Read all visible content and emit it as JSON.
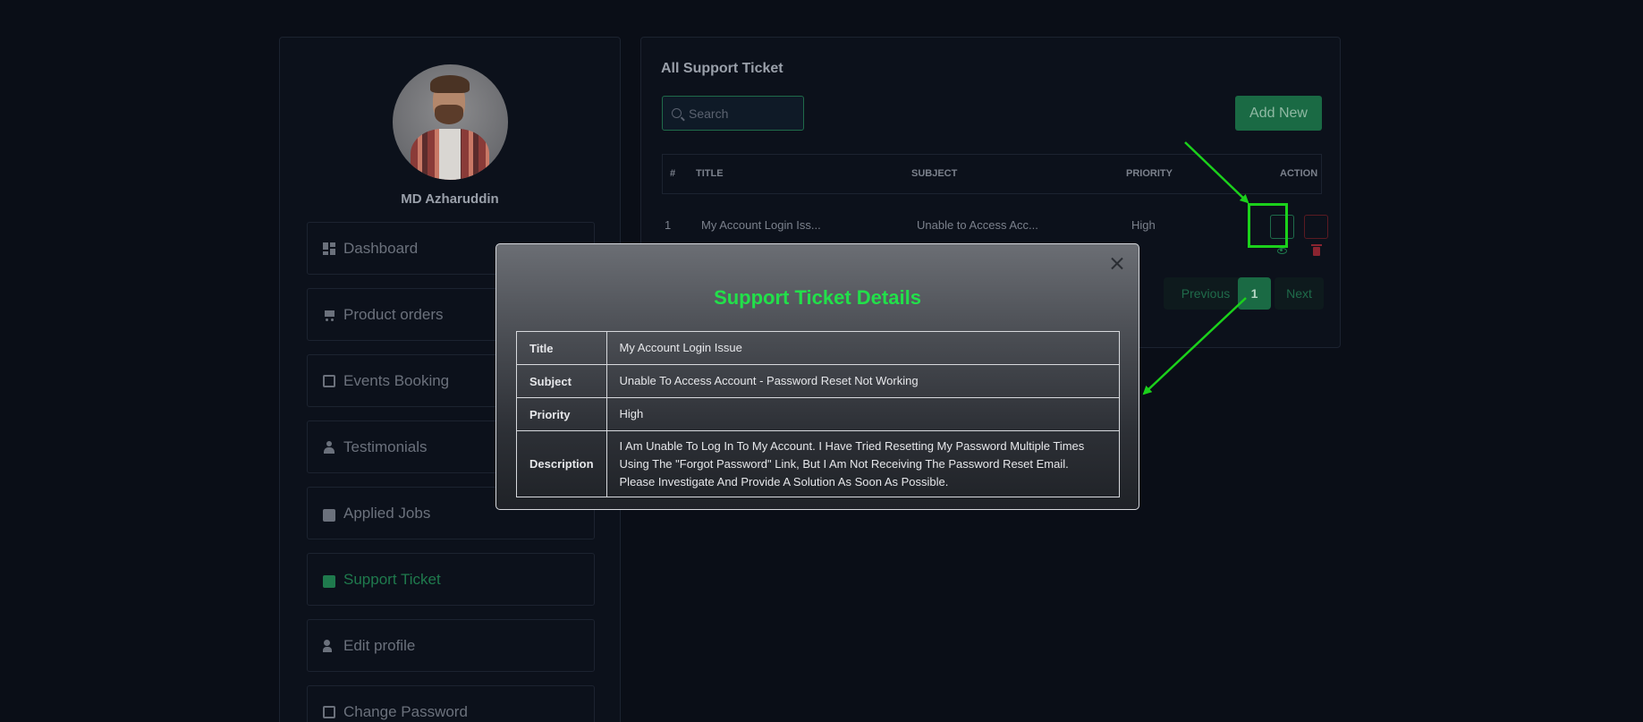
{
  "sidebar": {
    "user_name": "MD Azharuddin",
    "items": [
      {
        "label": "Dashboard",
        "icon": "dashboard-icon"
      },
      {
        "label": "Product orders",
        "icon": "cart-icon"
      },
      {
        "label": "Events Booking",
        "icon": "calendar-icon"
      },
      {
        "label": "Testimonials",
        "icon": "user-icon"
      },
      {
        "label": "Applied Jobs",
        "icon": "briefcase-icon"
      },
      {
        "label": "Support Ticket",
        "icon": "ticket-icon",
        "active": true
      },
      {
        "label": "Edit profile",
        "icon": "user-edit-icon"
      },
      {
        "label": "Change Password",
        "icon": "edit-icon"
      }
    ]
  },
  "main": {
    "title": "All Support Ticket",
    "search_placeholder": "Search",
    "add_button": "Add New",
    "columns": [
      "#",
      "TITLE",
      "SUBJECT",
      "PRIORITY",
      "ACTION"
    ],
    "rows": [
      {
        "num": "1",
        "title": "My Account Login Iss...",
        "subject": "Unable to Access Acc...",
        "priority": "High"
      }
    ],
    "pagination": {
      "previous": "Previous",
      "current": "1",
      "next": "Next"
    }
  },
  "modal": {
    "title": "Support Ticket Details",
    "fields": [
      {
        "key": "Title",
        "value": "My Account Login Issue"
      },
      {
        "key": "Subject",
        "value": "Unable To Access Account - Password Reset Not Working"
      },
      {
        "key": "Priority",
        "value": "High"
      },
      {
        "key": "Description",
        "value": "I Am Unable To Log In To My Account. I Have Tried Resetting My Password Multiple Times Using The \"Forgot Password\" Link, But I Am Not Receiving The Password Reset Email. Please Investigate And Provide A Solution As Soon As Possible."
      }
    ]
  },
  "colors": {
    "background": "#0a0e17",
    "accent": "#1a6a44",
    "modal_title": "#22e04a",
    "annotation": "#1bd11b",
    "danger": "#8a2430"
  }
}
